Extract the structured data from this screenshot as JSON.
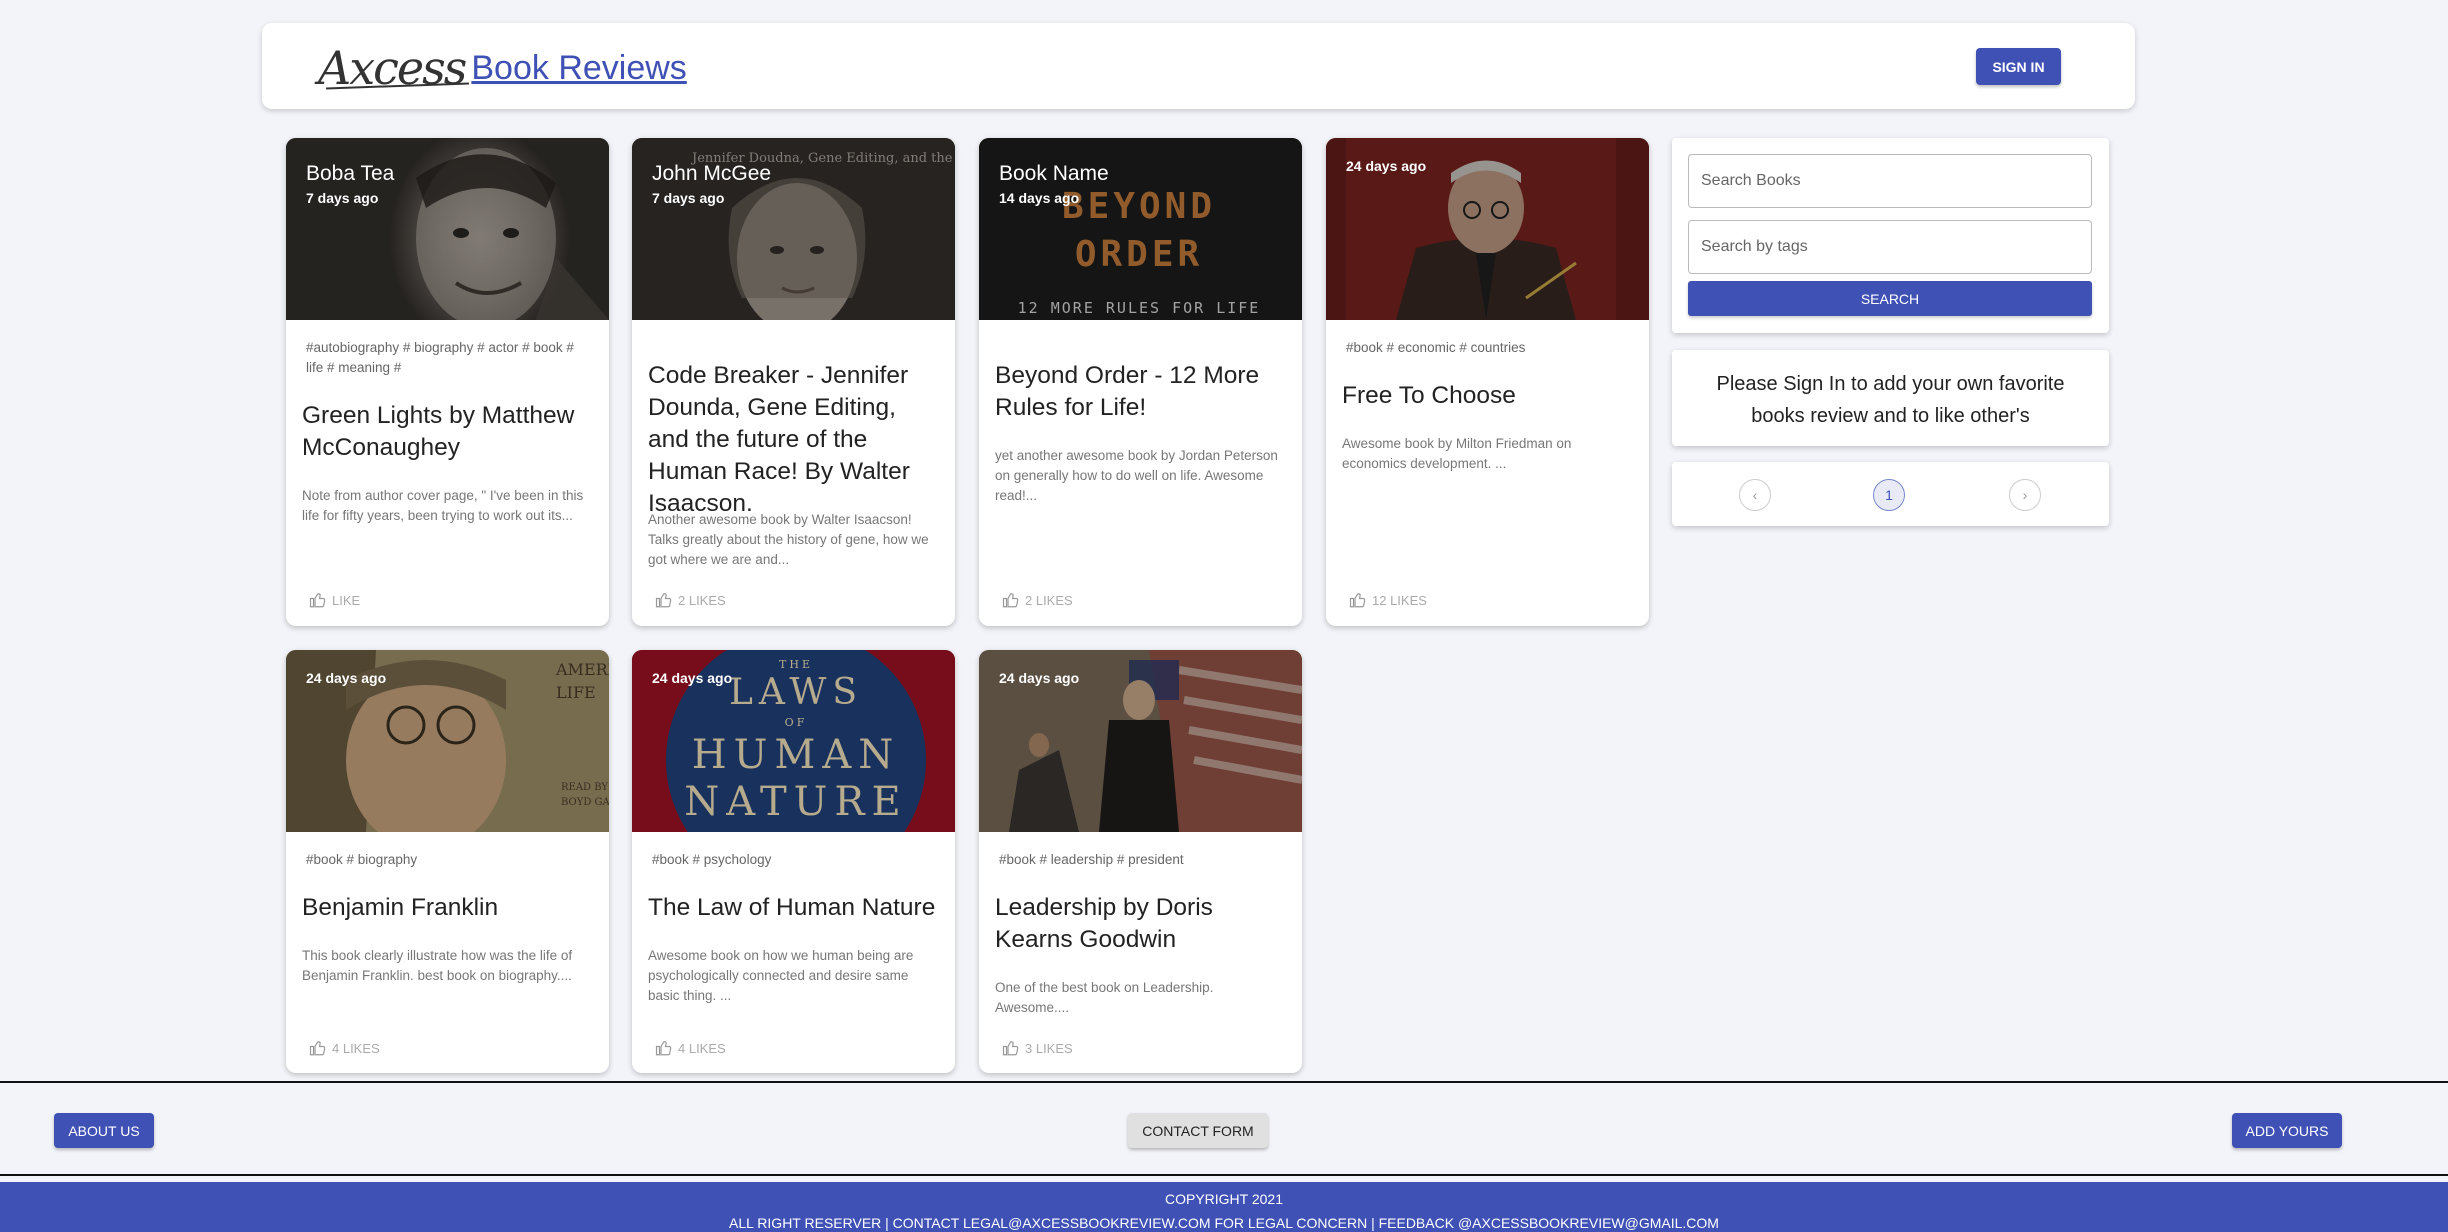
{
  "header": {
    "logo_script": "Axcess",
    "logo_title": "Book Reviews",
    "signin_label": "SIGN IN"
  },
  "cards": [
    {
      "author": "Boba Tea",
      "date": "7 days ago",
      "tags": "#autobiography # biography # actor # book # life # meaning #",
      "title": "Green Lights by Matthew McConaughey",
      "desc": "Note from author cover page, \" I've been in this life for fifty years, been trying to work out its...",
      "likes": "LIKE"
    },
    {
      "author": "John McGee",
      "date": "7 days ago",
      "tags": "",
      "title": "Code Breaker - Jennifer Dounda, Gene Editing, and the future of the Human Race! By Walter Isaacson.",
      "desc": "Another awesome book by Walter Isaacson! Talks greatly about the history of gene, how we got where we are and...",
      "likes": "2 LIKES"
    },
    {
      "author": "Book Name",
      "date": "14 days ago",
      "tags": "",
      "title": "Beyond Order - 12 More Rules for Life!",
      "desc": "yet another awesome book by Jordan Peterson on generally how to do well on life. Awesome read!...",
      "likes": "2 LIKES"
    },
    {
      "author": "",
      "date": "24 days ago",
      "tags": "#book # economic # countries",
      "title": "Free To Choose",
      "desc": "Awesome book by Milton Friedman on economics development. ...",
      "likes": "12 LIKES"
    },
    {
      "author": "",
      "date": "24 days ago",
      "tags": "#book # biography",
      "title": "Benjamin Franklin",
      "desc": "This book clearly illustrate how was the life of Benjamin Franklin. best book on biography....",
      "likes": "4 LIKES"
    },
    {
      "author": "",
      "date": "24 days ago",
      "tags": "#book # psychology",
      "title": "The Law of Human Nature",
      "desc": "Awesome book on how we human being are psychologically connected and desire same basic thing. ...",
      "likes": "4 LIKES"
    },
    {
      "author": "",
      "date": "24 days ago",
      "tags": "#book # leadership # president",
      "title": "Leadership by Doris Kearns Goodwin",
      "desc": "One of the best book on Leadership. Awesome....",
      "likes": "3 LIKES"
    }
  ],
  "covers": {
    "beyond_order": [
      "BEYOND",
      "ORDER",
      "12 MORE RULES FOR LIFE"
    ],
    "code_breaker": "Jennifer Doudna, Gene Editing, and the Future of the Human Race",
    "franklin": [
      "AMERICAN",
      "LIFE",
      "READ BY",
      "BOYD GAINES"
    ],
    "laws": [
      "THE",
      "LAWS",
      "OF",
      "HUMAN",
      "NATURE"
    ]
  },
  "sidebar": {
    "search_books_placeholder": "Search Books",
    "search_tags_placeholder": "Search by tags",
    "search_label": "SEARCH",
    "signin_message": "Please Sign In to add your own favorite books review and to like other's",
    "pagination": {
      "prev": "‹",
      "current": "1",
      "next": "›"
    }
  },
  "footer": {
    "about_label": "ABOUT US",
    "contact_label": "CONTACT FORM",
    "add_label": "ADD YOURS",
    "copyright": "COPYRIGHT 2021",
    "legal": "ALL RIGHT RESERVER | CONTACT LEGAL@AXCESSBOOKREVIEW.COM FOR LEGAL CONCERN | FEEDBACK @AXCESSBOOKREVIEW@GMAIL.COM"
  },
  "colors": {
    "primary": "#3f51b5",
    "background": "#f3f4f9"
  }
}
